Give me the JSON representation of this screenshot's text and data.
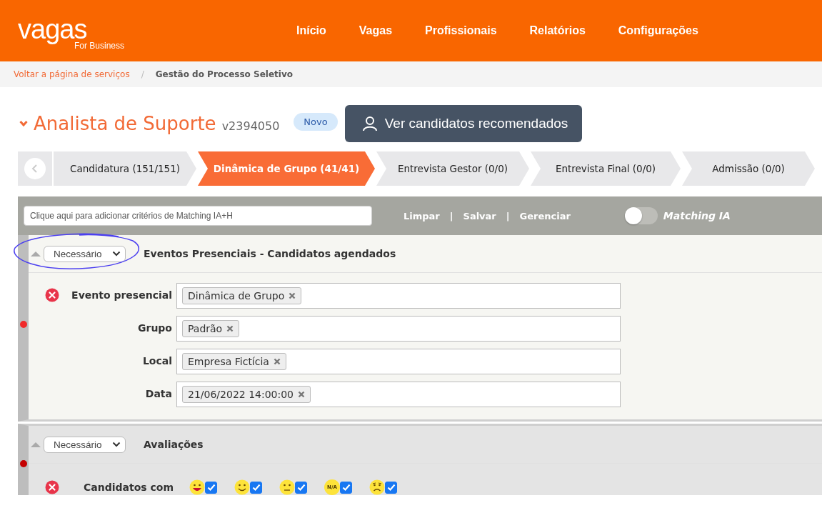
{
  "logo": {
    "wordmark": "vagas",
    "tagline": "For Business"
  },
  "nav": [
    "Início",
    "Vagas",
    "Profissionais",
    "Relatórios",
    "Configurações"
  ],
  "breadcrumb": {
    "link": "Voltar a página de serviços",
    "separator": "/",
    "current": "Gestão do Processo Seletivo"
  },
  "job": {
    "title": "Analista de Suporte",
    "code": "v2394050",
    "badge": "Novo",
    "expanded": true
  },
  "recommend_button": "Ver candidatos recomendados",
  "steps": [
    {
      "label": "Candidatura (151/151)",
      "selected": false
    },
    {
      "label": "Dinâmica de Grupo (41/41)",
      "selected": true
    },
    {
      "label": "Entrevista Gestor (0/0)",
      "selected": false
    },
    {
      "label": "Entrevista Final (0/0)",
      "selected": false
    },
    {
      "label": "Admissão (0/0)",
      "selected": false
    }
  ],
  "filter_bar": {
    "placeholder": "Clique aqui para adicionar critérios de Matching IA+H",
    "actions": [
      "Limpar",
      "Salvar",
      "Gerenciar"
    ],
    "separators": [
      "|",
      "|"
    ],
    "toggle": {
      "label": "Matching IA",
      "on": false
    }
  },
  "sections": [
    {
      "requirement": "Necessário",
      "title": "Eventos Presenciais - Candidatos agendados",
      "highlighted": true,
      "color": "#f02a2a",
      "fields": [
        {
          "label": "Evento presencial",
          "removable": true,
          "tags": [
            "Dinâmica de Grupo"
          ]
        },
        {
          "label": "Grupo",
          "removable": false,
          "tags": [
            "Padrão"
          ]
        },
        {
          "label": "Local",
          "removable": false,
          "tags": [
            "Empresa Fictícia"
          ]
        },
        {
          "label": "Data",
          "removable": false,
          "tags": [
            "21/06/2022 14:00:00"
          ]
        }
      ]
    },
    {
      "requirement": "Necessário",
      "title": "Avaliações",
      "highlighted": false,
      "color": "#c40000",
      "ratings": {
        "label": "Candidatos com",
        "removable": true,
        "items": [
          {
            "kind": "happy",
            "checked": true
          },
          {
            "kind": "smile",
            "checked": true
          },
          {
            "kind": "neutral",
            "checked": true
          },
          {
            "kind": "na",
            "text": "N/A",
            "checked": true
          },
          {
            "kind": "sad",
            "checked": true
          }
        ]
      }
    }
  ]
}
